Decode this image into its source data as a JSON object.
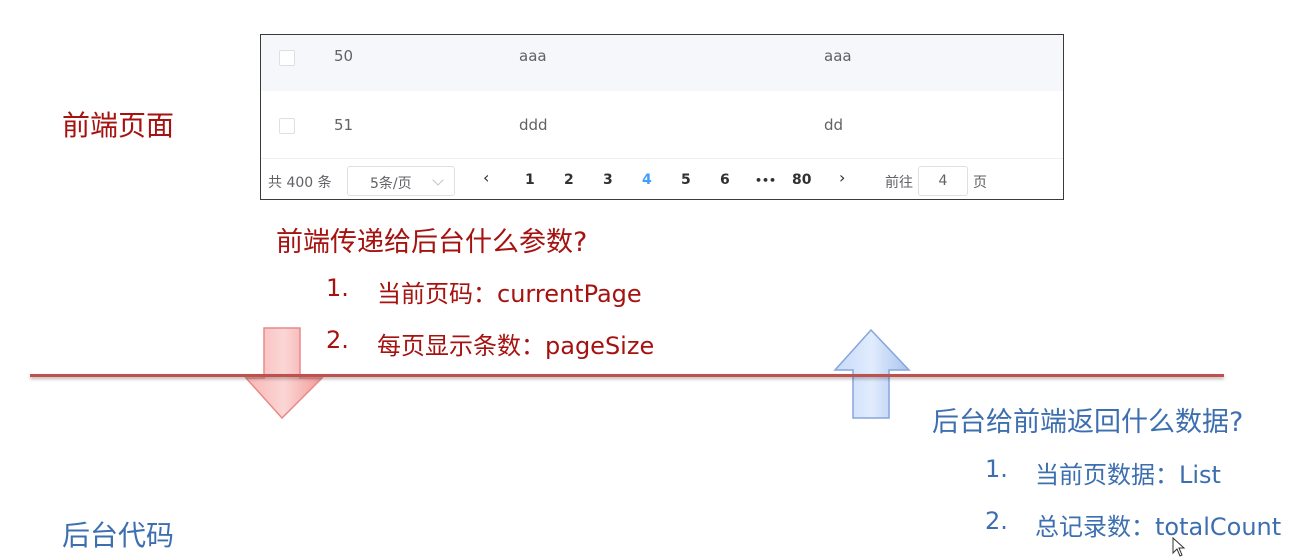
{
  "labels": {
    "frontend": "前端页面",
    "backend": "后台代码"
  },
  "table": {
    "rows": [
      {
        "id": "50",
        "col_a": "aaa",
        "col_b": "aaa"
      },
      {
        "id": "51",
        "col_a": "ddd",
        "col_b": "dd"
      }
    ]
  },
  "pagination": {
    "total_text": "共 400 条",
    "page_size": "5条/页",
    "prev_icon": "‹",
    "next_icon": "›",
    "pages": [
      "1",
      "2",
      "3",
      "4",
      "5",
      "6",
      "•••",
      "80"
    ],
    "current_page": "4",
    "goto_label": "前往",
    "goto_value": "4",
    "page_suffix": "页"
  },
  "frontend_to_backend": {
    "question": "前端传递给后台什么参数?",
    "items": [
      {
        "num": "1.",
        "text": "当前页码：currentPage"
      },
      {
        "num": "2.",
        "text": "每页显示条数：pageSize"
      }
    ]
  },
  "backend_to_frontend": {
    "question": "后台给前端返回什么数据?",
    "items": [
      {
        "num": "1.",
        "text": "当前页数据：List"
      },
      {
        "num": "2.",
        "text": "总记录数：totalCount"
      }
    ]
  },
  "colors": {
    "frontend_text": "#a5120f",
    "backend_text": "#3d6fb0",
    "divider": "#c0504d",
    "down_arrow": "#f4a3a2",
    "up_arrow": "#b9cff2",
    "active_page": "#409eff"
  }
}
